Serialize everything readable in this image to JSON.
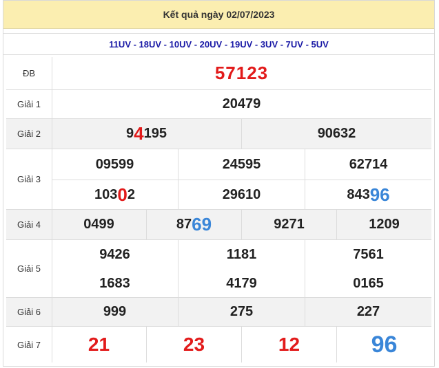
{
  "header": {
    "title": "Kết quả ngày 02/07/2023"
  },
  "codes": "11UV - 18UV - 10UV - 20UV - 19UV - 3UV - 7UV - 5UV",
  "rows": {
    "db": {
      "label": "ĐB",
      "value": "57123"
    },
    "g1": {
      "label": "Giải 1",
      "value": "20479"
    },
    "g2": {
      "label": "Giải 2",
      "values": [
        {
          "pre": "9",
          "hl": "4",
          "post": "195"
        },
        {
          "text": "90632"
        }
      ]
    },
    "g3": {
      "label": "Giải 3",
      "line1": [
        "09599",
        "24595",
        "62714"
      ],
      "line2": [
        {
          "pre": "103",
          "hl": "0",
          "post": "2"
        },
        {
          "text": "29610"
        },
        {
          "pre": "843",
          "hl": "96",
          "post": ""
        }
      ]
    },
    "g4": {
      "label": "Giải 4",
      "values": [
        {
          "text": "0499"
        },
        {
          "pre": "87",
          "hl": "69",
          "post": ""
        },
        {
          "text": "9271"
        },
        {
          "text": "1209"
        }
      ]
    },
    "g5": {
      "label": "Giải 5",
      "line1": [
        "9426",
        "1181",
        "7561"
      ],
      "line2": [
        "1683",
        "4179",
        "0165"
      ]
    },
    "g6": {
      "label": "Giải 6",
      "values": [
        "999",
        "275",
        "227"
      ]
    },
    "g7": {
      "label": "Giải 7",
      "values": [
        "21",
        "23",
        "12",
        "96"
      ]
    }
  },
  "colors": {
    "header_bg": "#fbeeb0",
    "codes": "#1a1aa6",
    "red": "#e21b1b",
    "blue": "#3a86d8"
  }
}
